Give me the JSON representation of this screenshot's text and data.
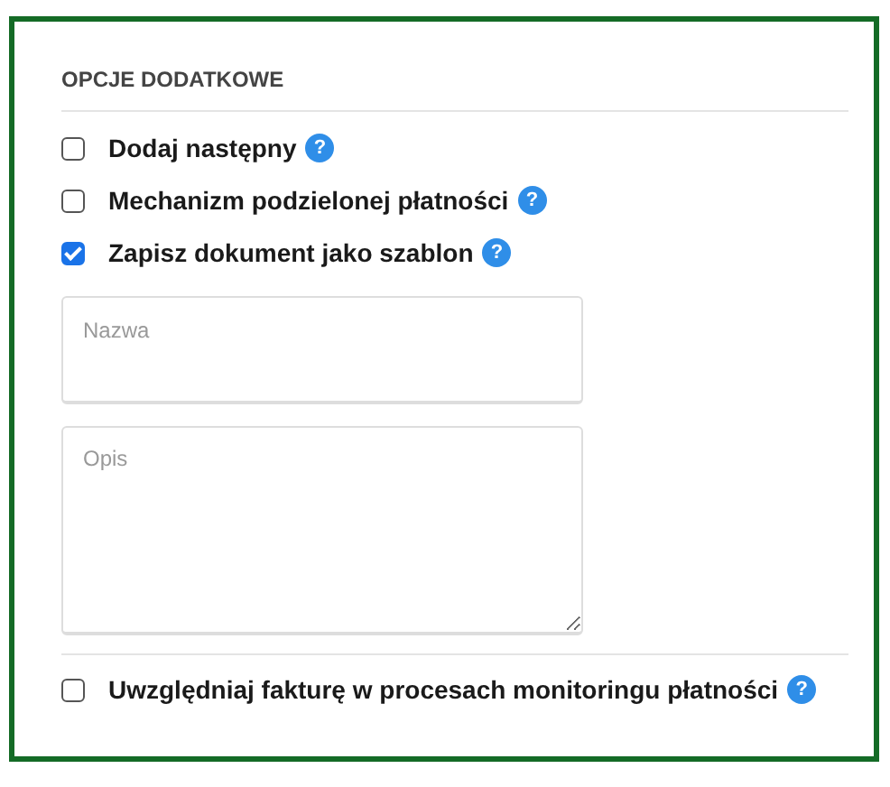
{
  "section": {
    "title": "OPCJE DODATKOWE"
  },
  "options": [
    {
      "label": "Dodaj następny",
      "checked": false,
      "help": "?"
    },
    {
      "label": "Mechanizm podzielonej płatności",
      "checked": false,
      "help": "?"
    },
    {
      "label": "Zapisz dokument jako szablon",
      "checked": true,
      "help": "?"
    }
  ],
  "template_fields": [
    {
      "kind": "input",
      "placeholder": "Nazwa"
    },
    {
      "kind": "textarea",
      "placeholder": "Opis"
    }
  ],
  "footer_option": {
    "label": "Uwzględniaj fakturę w procesach monitoringu płatności",
    "checked": false,
    "help": "?"
  }
}
